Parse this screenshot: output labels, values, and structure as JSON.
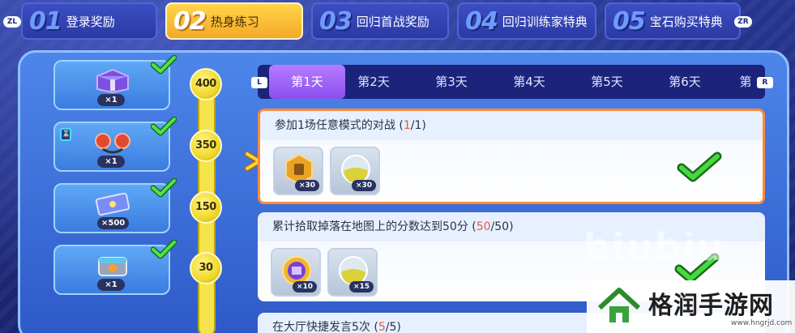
{
  "top_tabs": {
    "left_trigger": "ZL",
    "right_trigger": "ZR",
    "items": [
      {
        "num": "01",
        "label": "登录奖励"
      },
      {
        "num": "02",
        "label": "热身练习"
      },
      {
        "num": "03",
        "label": "回归首战奖励"
      },
      {
        "num": "04",
        "label": "回归训练家特典"
      },
      {
        "num": "05",
        "label": "宝石购买特典"
      }
    ]
  },
  "rewards": [
    {
      "qty": "×1",
      "icon": "mystery-box-icon"
    },
    {
      "qty": "×1",
      "icon": "headband-icon"
    },
    {
      "qty": "×500",
      "icon": "ticket-icon"
    },
    {
      "qty": "×1",
      "icon": "chest-icon"
    }
  ],
  "track": {
    "nodes": [
      "400",
      "350",
      "150",
      "30"
    ]
  },
  "day_tabs": {
    "left_key": "L",
    "right_key": "R",
    "items": [
      "第1天",
      "第2天",
      "第3天",
      "第4天",
      "第5天",
      "第6天",
      "第"
    ]
  },
  "tasks": [
    {
      "prefix": "参加1场任意模式的对战 (",
      "current": "1",
      "suffix": "/1)",
      "items": [
        {
          "qty": "×30",
          "icon": "coin-icon"
        },
        {
          "qty": "×30",
          "icon": "orb-icon"
        }
      ]
    },
    {
      "prefix": "累计拾取掉落在地图上的分数达到50分 (",
      "current": "50",
      "suffix": "/50)",
      "items": [
        {
          "qty": "×10",
          "icon": "purple-medal-icon"
        },
        {
          "qty": "×15",
          "icon": "orb-icon"
        }
      ]
    },
    {
      "prefix": "在大厅快捷发言5次 (",
      "current": "5",
      "suffix": "/5)",
      "items": []
    }
  ],
  "watermark": {
    "text": "格润手游网",
    "url": "www.hngrjd.com",
    "overlay": "biubiu"
  },
  "colors": {
    "accent": "#ffd54a",
    "selected_border": "#ff8a3a",
    "progress_current": "#e85a3a",
    "check": "#2fc93a"
  }
}
